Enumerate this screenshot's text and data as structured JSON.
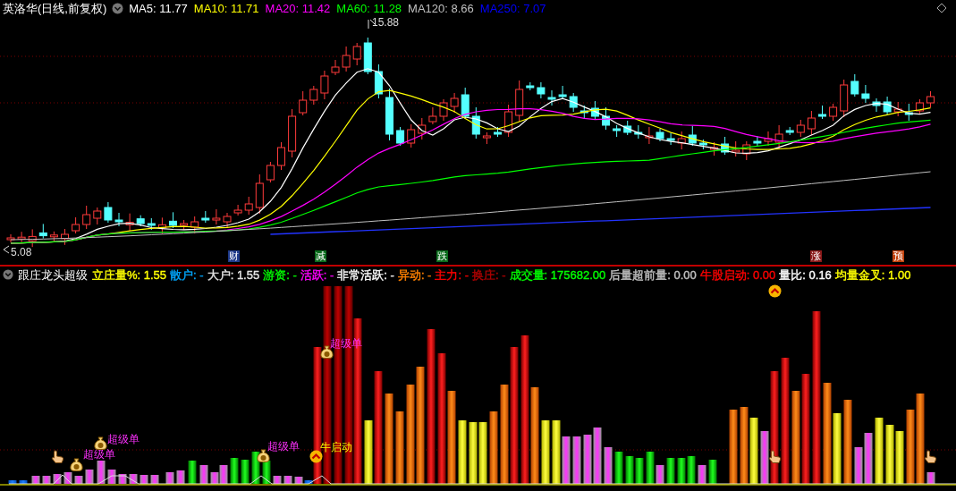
{
  "price_panel": {
    "title": "英洛华(日线,前复权)",
    "indicators": [
      {
        "label": "MA5: 11.77",
        "color": "#ffffff"
      },
      {
        "label": "MA10: 11.71",
        "color": "#ffff00"
      },
      {
        "label": "MA20: 11.42",
        "color": "#ff00ff"
      },
      {
        "label": "MA60: 11.28",
        "color": "#00ff00"
      },
      {
        "label": "MA120: 8.66",
        "color": "#c0c0c0"
      },
      {
        "label": "MA250: 7.07",
        "color": "#0000ff"
      }
    ],
    "high_label": "15.88",
    "low_label": "5.08",
    "event_markers": [
      {
        "label": "财",
        "color": "#1e3a8a"
      },
      {
        "label": "减",
        "color": "#0b6b1c"
      },
      {
        "label": "跌",
        "color": "#0b6b1c"
      },
      {
        "label": "涨",
        "color": "#8b1a1a"
      },
      {
        "label": "预",
        "color": "#c2410c"
      }
    ]
  },
  "indicator_panel": {
    "title": "跟庄龙头超级",
    "readouts": [
      {
        "label": "立庄量%: 1.55",
        "color": "#ffff00"
      },
      {
        "label": "散户: -",
        "color": "#00a8ff"
      },
      {
        "label": "大户: 1.55",
        "color": "#e5e5e5"
      },
      {
        "label": "游资: -",
        "color": "#00ff00"
      },
      {
        "label": "活跃: -",
        "color": "#ff00ff"
      },
      {
        "label": "非常活跃: -",
        "color": "#ffffff"
      },
      {
        "label": "异动: -",
        "color": "#ff8000"
      },
      {
        "label": "主力: -",
        "color": "#ff0000"
      },
      {
        "label": "换庄: -",
        "color": "#b00000"
      },
      {
        "label": "成交量: 175682.00",
        "color": "#00ff00"
      },
      {
        "label": "后量超前量: 0.00",
        "color": "#c0c0c0"
      },
      {
        "label": "牛股启动: 0.00",
        "color": "#ff0000"
      },
      {
        "label": "量比: 0.16",
        "color": "#ffffff"
      },
      {
        "label": "均量金叉: 1.00",
        "color": "#ffff00"
      }
    ],
    "signals": [
      {
        "kind": "money-bag",
        "label": "超级单"
      },
      {
        "kind": "money-bag",
        "label": "超级单"
      },
      {
        "kind": "money-bag",
        "label": "超级单"
      },
      {
        "kind": "money-bag",
        "label": "超级单"
      },
      {
        "kind": "bull-start",
        "label": "牛启动"
      }
    ]
  }
}
